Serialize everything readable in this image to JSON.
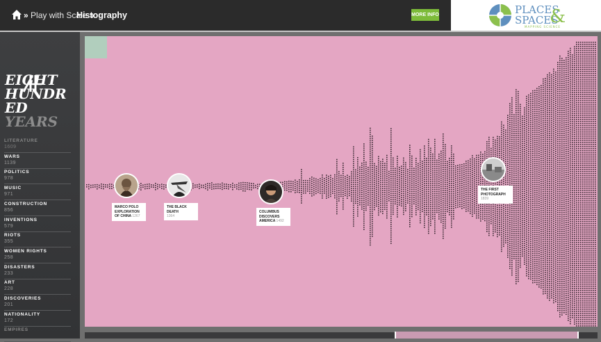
{
  "breadcrumb": {
    "separator": "»",
    "parent": "Play with Scale",
    "current": "Histography"
  },
  "header": {
    "more_info_label": "MORE INFO",
    "logo": {
      "line1": "PLACES",
      "ampersand": "&",
      "line2": "SPACES",
      "tagline": "MAPPING SCIENCE"
    }
  },
  "sidebar": {
    "title_lines": [
      "EIGHT",
      "HUNDR",
      "ED"
    ],
    "title_dim_line": "YEARS",
    "categories": [
      {
        "name": "LITERATURE",
        "count": "1609",
        "faded": true
      },
      {
        "name": "WARS",
        "count": "1139"
      },
      {
        "name": "POLITICS",
        "count": "978"
      },
      {
        "name": "MUSIC",
        "count": "971"
      },
      {
        "name": "CONSTRUCTION",
        "count": "856"
      },
      {
        "name": "INVENTIONS",
        "count": "579"
      },
      {
        "name": "RIOTS",
        "count": "355"
      },
      {
        "name": "WOMEN RIGHTS",
        "count": "258"
      },
      {
        "name": "DISASTERS",
        "count": "233"
      },
      {
        "name": "ART",
        "count": "228"
      },
      {
        "name": "DISCOVERIES",
        "count": "201"
      },
      {
        "name": "NATIONALITY",
        "count": "172"
      },
      {
        "name": "EMPIRES",
        "count": "",
        "faded": true
      }
    ]
  },
  "events": [
    {
      "title": "MARCO POLO EXPLORATION OF CHINA",
      "year": "1267"
    },
    {
      "title": "THE BLACK DEATH",
      "year": "1364"
    },
    {
      "title": "COLUMBUS DISCOVERS AMERICA",
      "year": "1492"
    },
    {
      "title": "THE FIRST PHOTOGRAPH",
      "year": "1839"
    }
  ],
  "colors": {
    "chart_bg": "#e4a6c3",
    "dot": "#3a2a33",
    "accent_green": "#7dbb3a",
    "sidebar_bg": "#3a3b3d"
  }
}
